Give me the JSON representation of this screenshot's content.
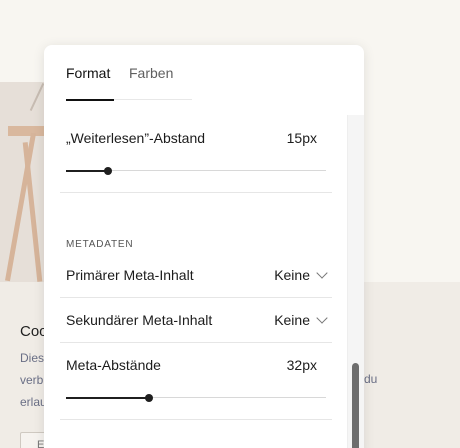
{
  "background": {
    "card_title": "Coo",
    "card_lines": [
      "Dies",
      "verb",
      "erlau"
    ],
    "card_right_text": "du",
    "button_text": "E"
  },
  "panel": {
    "tabs": [
      {
        "label": "Format",
        "active": true
      },
      {
        "label": "Farben",
        "active": false
      }
    ],
    "read_more_spacing": {
      "label": "„Weiterlesen”-Abstand",
      "value": "15px",
      "level": 0.16
    },
    "metadata": {
      "heading": "METADATEN",
      "primary": {
        "label": "Primärer Meta-Inhalt",
        "value": "Keine"
      },
      "secondary": {
        "label": "Sekundärer Meta-Inhalt",
        "value": "Keine"
      }
    },
    "meta_spacing": {
      "label": "Meta-Abstände",
      "value": "32px",
      "level": 0.32
    }
  },
  "colors": {
    "accent": "#1f1f1f",
    "panel_bg": "#ffffff",
    "page_bg": "#f8f6f1"
  }
}
